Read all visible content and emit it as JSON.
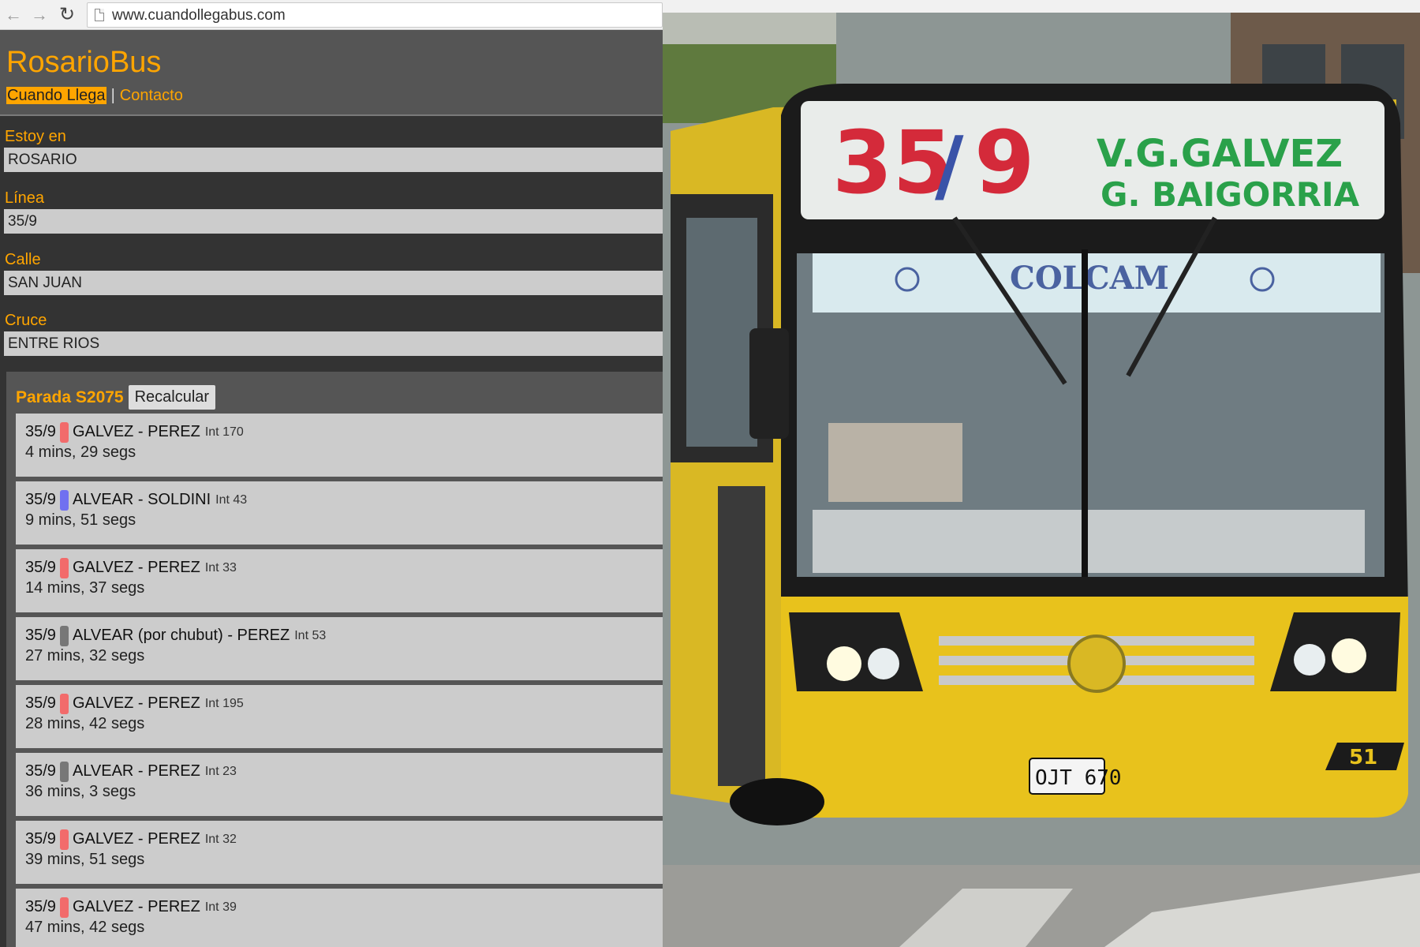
{
  "browser": {
    "url": "www.cuandollegabus.com"
  },
  "app": {
    "brand": "RosarioBus",
    "nav": [
      {
        "label": "Cuando Llega",
        "active": true
      },
      {
        "label": "Contacto",
        "active": false
      }
    ],
    "nav_separator": "|"
  },
  "form": {
    "city": {
      "label": "Estoy en",
      "value": "ROSARIO"
    },
    "line": {
      "label": "Línea",
      "value": "35/9"
    },
    "street": {
      "label": "Calle",
      "value": "SAN JUAN"
    },
    "cross": {
      "label": "Cruce",
      "value": "ENTRE RIOS"
    }
  },
  "stop": {
    "name": "Parada S2075",
    "recalc_label": "Recalcular",
    "arrivals": [
      {
        "line": "35/9",
        "color": "#f26b6b",
        "dest": "GALVEZ - PEREZ",
        "int": "Int 170",
        "eta": "4 mins, 29 segs"
      },
      {
        "line": "35/9",
        "color": "#7070f0",
        "dest": "ALVEAR - SOLDINI",
        "int": "Int 43",
        "eta": "9 mins, 51 segs"
      },
      {
        "line": "35/9",
        "color": "#f26b6b",
        "dest": "GALVEZ - PEREZ",
        "int": "Int 33",
        "eta": "14 mins, 37 segs"
      },
      {
        "line": "35/9",
        "color": "#777777",
        "dest": "ALVEAR (por chubut) - PEREZ",
        "int": "Int 53",
        "eta": "27 mins, 32 segs"
      },
      {
        "line": "35/9",
        "color": "#f26b6b",
        "dest": "GALVEZ - PEREZ",
        "int": "Int 195",
        "eta": "28 mins, 42 segs"
      },
      {
        "line": "35/9",
        "color": "#777777",
        "dest": "ALVEAR - PEREZ",
        "int": "Int 23",
        "eta": "36 mins, 3 segs"
      },
      {
        "line": "35/9",
        "color": "#f26b6b",
        "dest": "GALVEZ - PEREZ",
        "int": "Int 32",
        "eta": "39 mins, 51 segs"
      },
      {
        "line": "35/9",
        "color": "#f26b6b",
        "dest": "GALVEZ - PEREZ",
        "int": "Int 39",
        "eta": "47 mins, 42 segs"
      }
    ]
  },
  "photo": {
    "sign_number": "35",
    "sign_slash": "/",
    "sign_sub": "9",
    "sign_dest1": "V.G.GALVEZ",
    "sign_dest2": "G. BAIGORRIA",
    "company": "COLCAM",
    "fleet_number": "51",
    "plate": "OJT 670"
  }
}
